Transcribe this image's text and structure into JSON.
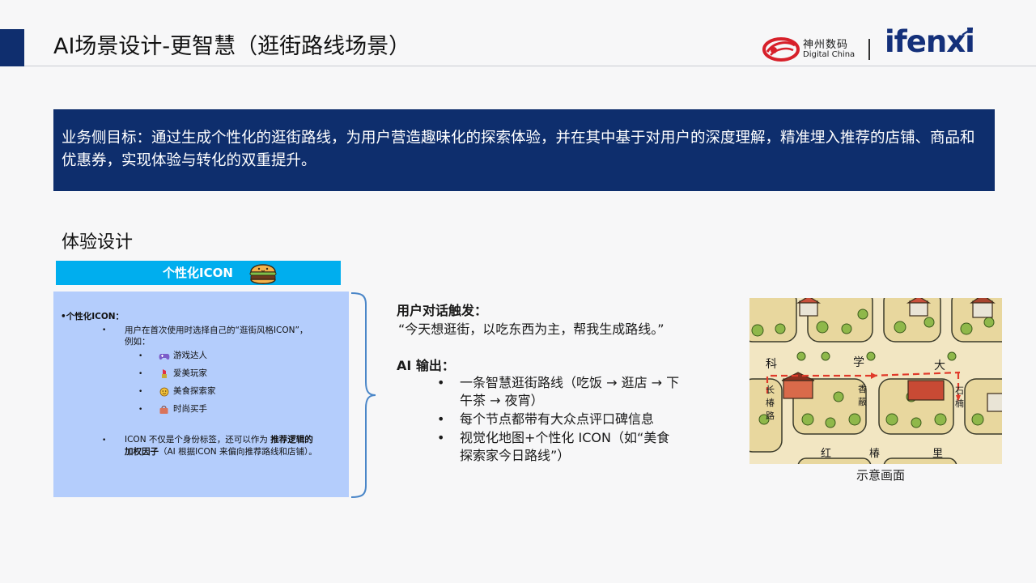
{
  "header": {
    "title": "AI场景设计-更智慧（逛街路线场景）",
    "logo_dc_cn": "神州数码",
    "logo_dc_en": "Digital China",
    "logo_ifenxi": "ifenxi"
  },
  "banner": {
    "text": "业务侧目标：通过生成个性化的逛街路线，为用户营造趣味化的探索体验，并在其中基于对用户的深度理解，精准埋入推荐的店铺、商品和优惠券，实现体验与转化的双重提升。"
  },
  "section": {
    "title": "体验设计",
    "icon_header_label": "个性化ICON",
    "icon_box": {
      "heading": "•个性化ICON：",
      "line1": "用户在首次使用时选择自己的“逛街风格ICON”，",
      "line2": "例如：",
      "options": [
        "游戏达人",
        "爱美玩家",
        "美食探索家",
        "时尚买手"
      ],
      "note_line1_pre": "ICON 不仅是个身份标签，还可以作为 ",
      "note_line1_bold": "推荐逻辑的",
      "note_line2_bold": "加权因子",
      "note_line2_post": "（AI 根据ICON 来偏向推荐路线和店铺）。"
    }
  },
  "middle": {
    "trigger_label": "用户对话触发：",
    "trigger_quote": "“今天想逛街，以吃东西为主，帮我生成路线。”",
    "ai_label": "AI 输出：",
    "items": [
      [
        "一条智慧逛街路线（吃饭 → 逛店 → 下",
        "午茶 → 夜宵）"
      ],
      [
        "每个节点都带有大众点评口碑信息"
      ],
      [
        "视觉化地图+个性化 ICON（如“美食",
        "探索家今日路线”）"
      ]
    ]
  },
  "map": {
    "caption": "示意画面",
    "labels": [
      "科",
      "学",
      "大",
      "长",
      "椿",
      "路",
      "香",
      "蔽",
      "石",
      "楠",
      "红",
      "椿",
      "里"
    ],
    "colors": {
      "paper": "#f2e6c2",
      "road": "#f6efd8",
      "block": "#e8d79e",
      "tree": "#8fb84a",
      "route": "#e03a2a"
    }
  },
  "colors": {
    "navy": "#0e2e6d",
    "cyan": "#00aeee",
    "light_blue": "#b4cdfc"
  }
}
